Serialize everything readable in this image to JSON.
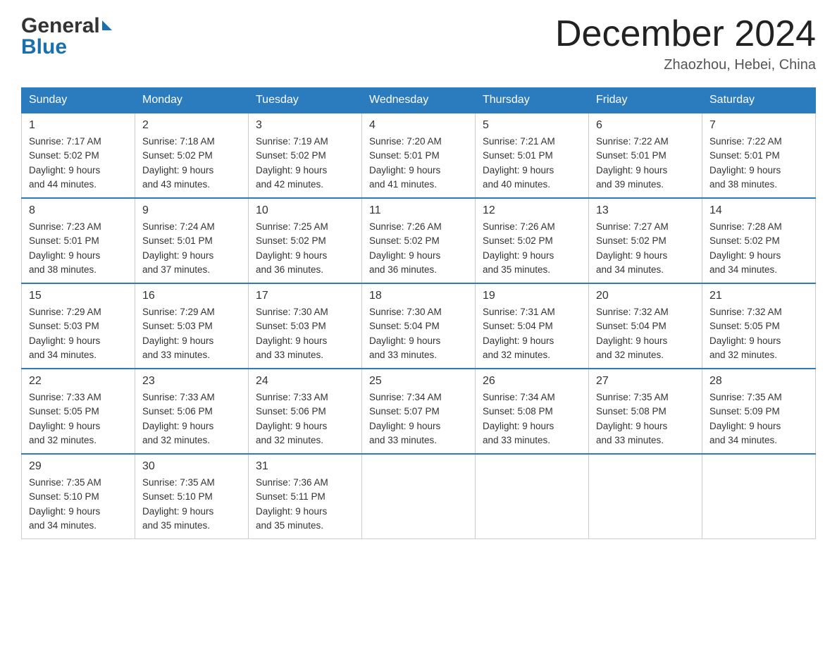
{
  "header": {
    "logo_general": "General",
    "logo_blue": "Blue",
    "title": "December 2024",
    "location": "Zhaozhou, Hebei, China"
  },
  "days_of_week": [
    "Sunday",
    "Monday",
    "Tuesday",
    "Wednesday",
    "Thursday",
    "Friday",
    "Saturday"
  ],
  "weeks": [
    [
      {
        "day": "1",
        "sunrise": "Sunrise: 7:17 AM",
        "sunset": "Sunset: 5:02 PM",
        "daylight": "Daylight: 9 hours",
        "minutes": "and 44 minutes."
      },
      {
        "day": "2",
        "sunrise": "Sunrise: 7:18 AM",
        "sunset": "Sunset: 5:02 PM",
        "daylight": "Daylight: 9 hours",
        "minutes": "and 43 minutes."
      },
      {
        "day": "3",
        "sunrise": "Sunrise: 7:19 AM",
        "sunset": "Sunset: 5:02 PM",
        "daylight": "Daylight: 9 hours",
        "minutes": "and 42 minutes."
      },
      {
        "day": "4",
        "sunrise": "Sunrise: 7:20 AM",
        "sunset": "Sunset: 5:01 PM",
        "daylight": "Daylight: 9 hours",
        "minutes": "and 41 minutes."
      },
      {
        "day": "5",
        "sunrise": "Sunrise: 7:21 AM",
        "sunset": "Sunset: 5:01 PM",
        "daylight": "Daylight: 9 hours",
        "minutes": "and 40 minutes."
      },
      {
        "day": "6",
        "sunrise": "Sunrise: 7:22 AM",
        "sunset": "Sunset: 5:01 PM",
        "daylight": "Daylight: 9 hours",
        "minutes": "and 39 minutes."
      },
      {
        "day": "7",
        "sunrise": "Sunrise: 7:22 AM",
        "sunset": "Sunset: 5:01 PM",
        "daylight": "Daylight: 9 hours",
        "minutes": "and 38 minutes."
      }
    ],
    [
      {
        "day": "8",
        "sunrise": "Sunrise: 7:23 AM",
        "sunset": "Sunset: 5:01 PM",
        "daylight": "Daylight: 9 hours",
        "minutes": "and 38 minutes."
      },
      {
        "day": "9",
        "sunrise": "Sunrise: 7:24 AM",
        "sunset": "Sunset: 5:01 PM",
        "daylight": "Daylight: 9 hours",
        "minutes": "and 37 minutes."
      },
      {
        "day": "10",
        "sunrise": "Sunrise: 7:25 AM",
        "sunset": "Sunset: 5:02 PM",
        "daylight": "Daylight: 9 hours",
        "minutes": "and 36 minutes."
      },
      {
        "day": "11",
        "sunrise": "Sunrise: 7:26 AM",
        "sunset": "Sunset: 5:02 PM",
        "daylight": "Daylight: 9 hours",
        "minutes": "and 36 minutes."
      },
      {
        "day": "12",
        "sunrise": "Sunrise: 7:26 AM",
        "sunset": "Sunset: 5:02 PM",
        "daylight": "Daylight: 9 hours",
        "minutes": "and 35 minutes."
      },
      {
        "day": "13",
        "sunrise": "Sunrise: 7:27 AM",
        "sunset": "Sunset: 5:02 PM",
        "daylight": "Daylight: 9 hours",
        "minutes": "and 34 minutes."
      },
      {
        "day": "14",
        "sunrise": "Sunrise: 7:28 AM",
        "sunset": "Sunset: 5:02 PM",
        "daylight": "Daylight: 9 hours",
        "minutes": "and 34 minutes."
      }
    ],
    [
      {
        "day": "15",
        "sunrise": "Sunrise: 7:29 AM",
        "sunset": "Sunset: 5:03 PM",
        "daylight": "Daylight: 9 hours",
        "minutes": "and 34 minutes."
      },
      {
        "day": "16",
        "sunrise": "Sunrise: 7:29 AM",
        "sunset": "Sunset: 5:03 PM",
        "daylight": "Daylight: 9 hours",
        "minutes": "and 33 minutes."
      },
      {
        "day": "17",
        "sunrise": "Sunrise: 7:30 AM",
        "sunset": "Sunset: 5:03 PM",
        "daylight": "Daylight: 9 hours",
        "minutes": "and 33 minutes."
      },
      {
        "day": "18",
        "sunrise": "Sunrise: 7:30 AM",
        "sunset": "Sunset: 5:04 PM",
        "daylight": "Daylight: 9 hours",
        "minutes": "and 33 minutes."
      },
      {
        "day": "19",
        "sunrise": "Sunrise: 7:31 AM",
        "sunset": "Sunset: 5:04 PM",
        "daylight": "Daylight: 9 hours",
        "minutes": "and 32 minutes."
      },
      {
        "day": "20",
        "sunrise": "Sunrise: 7:32 AM",
        "sunset": "Sunset: 5:04 PM",
        "daylight": "Daylight: 9 hours",
        "minutes": "and 32 minutes."
      },
      {
        "day": "21",
        "sunrise": "Sunrise: 7:32 AM",
        "sunset": "Sunset: 5:05 PM",
        "daylight": "Daylight: 9 hours",
        "minutes": "and 32 minutes."
      }
    ],
    [
      {
        "day": "22",
        "sunrise": "Sunrise: 7:33 AM",
        "sunset": "Sunset: 5:05 PM",
        "daylight": "Daylight: 9 hours",
        "minutes": "and 32 minutes."
      },
      {
        "day": "23",
        "sunrise": "Sunrise: 7:33 AM",
        "sunset": "Sunset: 5:06 PM",
        "daylight": "Daylight: 9 hours",
        "minutes": "and 32 minutes."
      },
      {
        "day": "24",
        "sunrise": "Sunrise: 7:33 AM",
        "sunset": "Sunset: 5:06 PM",
        "daylight": "Daylight: 9 hours",
        "minutes": "and 32 minutes."
      },
      {
        "day": "25",
        "sunrise": "Sunrise: 7:34 AM",
        "sunset": "Sunset: 5:07 PM",
        "daylight": "Daylight: 9 hours",
        "minutes": "and 33 minutes."
      },
      {
        "day": "26",
        "sunrise": "Sunrise: 7:34 AM",
        "sunset": "Sunset: 5:08 PM",
        "daylight": "Daylight: 9 hours",
        "minutes": "and 33 minutes."
      },
      {
        "day": "27",
        "sunrise": "Sunrise: 7:35 AM",
        "sunset": "Sunset: 5:08 PM",
        "daylight": "Daylight: 9 hours",
        "minutes": "and 33 minutes."
      },
      {
        "day": "28",
        "sunrise": "Sunrise: 7:35 AM",
        "sunset": "Sunset: 5:09 PM",
        "daylight": "Daylight: 9 hours",
        "minutes": "and 34 minutes."
      }
    ],
    [
      {
        "day": "29",
        "sunrise": "Sunrise: 7:35 AM",
        "sunset": "Sunset: 5:10 PM",
        "daylight": "Daylight: 9 hours",
        "minutes": "and 34 minutes."
      },
      {
        "day": "30",
        "sunrise": "Sunrise: 7:35 AM",
        "sunset": "Sunset: 5:10 PM",
        "daylight": "Daylight: 9 hours",
        "minutes": "and 35 minutes."
      },
      {
        "day": "31",
        "sunrise": "Sunrise: 7:36 AM",
        "sunset": "Sunset: 5:11 PM",
        "daylight": "Daylight: 9 hours",
        "minutes": "and 35 minutes."
      },
      null,
      null,
      null,
      null
    ]
  ]
}
